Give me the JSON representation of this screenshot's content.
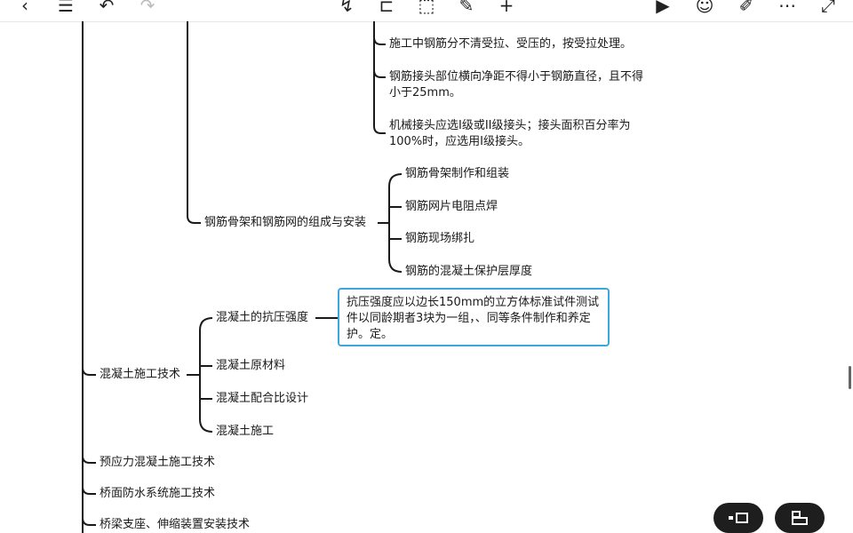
{
  "toolbar": {
    "left": [
      {
        "name": "back-icon",
        "glyph": "‹"
      },
      {
        "name": "outline-list-icon",
        "glyph": "☰"
      },
      {
        "name": "undo-icon",
        "glyph": "↶"
      },
      {
        "name": "redo-icon",
        "glyph": "↷",
        "disabled": true
      }
    ],
    "center": [
      {
        "name": "connector-icon",
        "glyph": "↯"
      },
      {
        "name": "structure-icon",
        "glyph": "⊏"
      },
      {
        "name": "select-box-icon",
        "glyph": "⬚"
      },
      {
        "name": "edit-note-icon",
        "glyph": "✎"
      },
      {
        "name": "add-icon",
        "glyph": "+"
      }
    ],
    "right": [
      {
        "name": "play-icon",
        "glyph": "▶"
      },
      {
        "name": "emoji-icon",
        "glyph": "☺"
      },
      {
        "name": "format-brush-icon",
        "glyph": "✐"
      },
      {
        "name": "more-icon",
        "glyph": "⋯"
      },
      {
        "name": "expand-icon",
        "glyph": "⤢"
      }
    ]
  },
  "mindmap": {
    "rebar_notes": {
      "n1": "施工中钢筋分不清受拉、受压的，按受拉处理。",
      "n2": "钢筋接头部位横向净距不得小于钢筋直径，且不得小于25mm。",
      "n3": "机械接头应选I级或II级接头；接头面积百分率为100%时，应选用I级接头。"
    },
    "skeleton_topic": "钢筋骨架和钢筋网的组成与安装",
    "skeleton_children": [
      "钢筋骨架制作和组装",
      "钢筋网片电阻点焊",
      "钢筋现场绑扎",
      "钢筋的混凝土保护层厚度"
    ],
    "concrete_topic": "混凝土施工技术",
    "concrete_children": [
      "混凝土的抗压强度",
      "混凝土原材料",
      "混凝土配合比设计",
      "混凝土施工"
    ],
    "compressive_note": "抗压强度应以边长150mm的立方体标准试件测试件以同龄期者3块为一组，、同等条件制作和养定护。定。",
    "siblings": [
      "预应力混凝土施工技术",
      "桥面防水系统施工技术",
      "桥梁支座、伸缩装置安装技术"
    ]
  },
  "fabs": [
    {
      "name": "insert-sibling-icon",
      "glyph": "▪▭"
    },
    {
      "name": "insert-child-icon",
      "glyph": "⊟"
    }
  ],
  "colors": {
    "line": "#1a1a1a",
    "focus_border": "#3aa7e0",
    "fab_bg": "#1e1e1e"
  }
}
